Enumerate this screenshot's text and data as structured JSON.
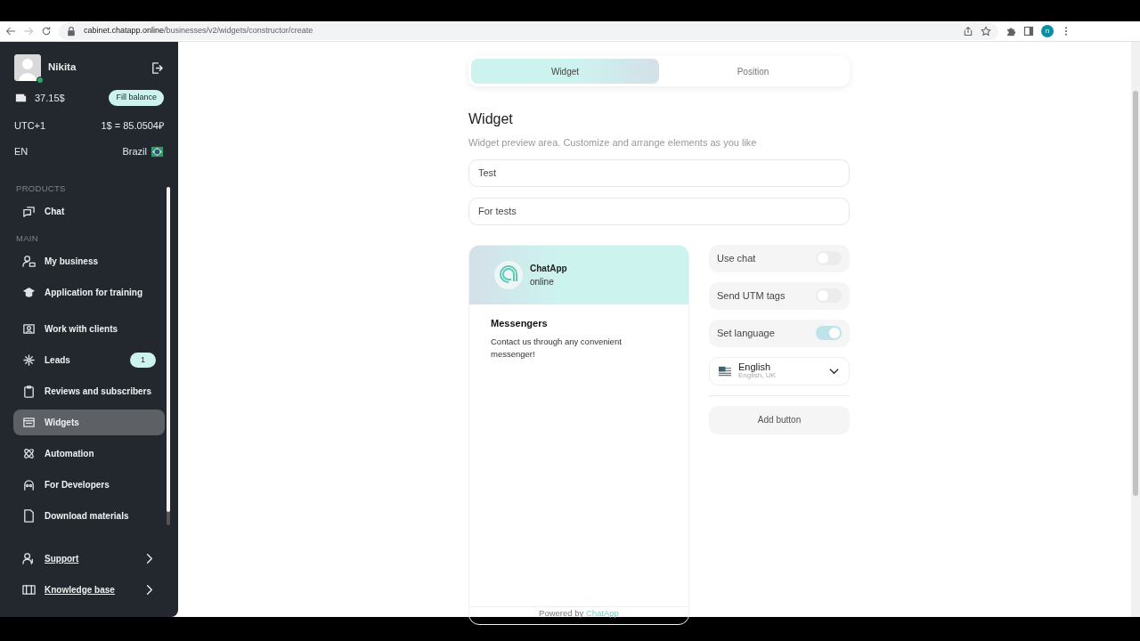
{
  "browser": {
    "url_host": "cabinet.chatapp.online",
    "url_path": "/businesses/v2/widgets/constructor/create",
    "profile_initial": "n"
  },
  "sidebar": {
    "user": {
      "name": "Nikita",
      "online": true
    },
    "balance": "37.15$",
    "fill_button": "Fill balance",
    "timezone": "UTC+1",
    "rate": "1$ = 85.0504₽",
    "language": "EN",
    "country": "Brazil",
    "sections": [
      {
        "title": "PRODUCTS",
        "items": [
          {
            "label": "Chat",
            "selected": false
          }
        ]
      },
      {
        "title": "MAIN",
        "items": [
          {
            "label": "My business",
            "selected": false
          },
          {
            "label": "Application for training",
            "selected": false
          },
          {
            "label": "Work with clients",
            "selected": false
          },
          {
            "label": "Leads",
            "selected": false,
            "badge": "1"
          },
          {
            "label": "Reviews and subscribers",
            "selected": false
          },
          {
            "label": "Widgets",
            "selected": true
          },
          {
            "label": "Automation",
            "selected": false
          },
          {
            "label": "For Developers",
            "selected": false
          },
          {
            "label": "Download materials",
            "selected": false
          }
        ]
      }
    ],
    "footer_links": [
      {
        "label": "Support"
      },
      {
        "label": "Knowledge base"
      }
    ]
  },
  "main": {
    "tabs": [
      {
        "label": "Widget",
        "selected": true
      },
      {
        "label": "Position",
        "selected": false
      }
    ],
    "heading": "Widget",
    "description": "Widget preview area. Customize and arrange elements as you like",
    "fields": [
      {
        "value": "Test"
      },
      {
        "value": "For tests"
      }
    ],
    "preview": {
      "brand": "ChatApp",
      "status": "online",
      "title": "Messengers",
      "text": "Contact us through any convenient messenger!",
      "footer_prefix": "Powered by",
      "footer_link": "ChatApp"
    },
    "toggles": [
      {
        "label": "Use chat",
        "on": false
      },
      {
        "label": "Send UTM tags",
        "on": false
      },
      {
        "label": "Set language",
        "on": true
      }
    ],
    "language_select": {
      "label": "English",
      "sublabel": "English, UK"
    },
    "add_button": "Add button"
  }
}
